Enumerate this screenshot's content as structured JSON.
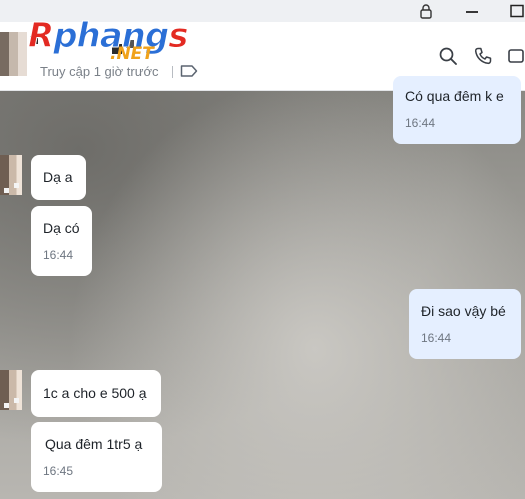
{
  "titlebar": {
    "icons": [
      "lock-icon",
      "minimize-icon",
      "maximize-icon"
    ]
  },
  "header": {
    "logo_main": "Rphangs",
    "logo_first": "R",
    "logo_mid": "phang",
    "logo_last": "s",
    "logo_sub": ".NET",
    "status": "Truy cập 1 giờ trước",
    "icons": [
      "tag-icon",
      "search-icon",
      "phone-icon",
      "video-icon"
    ]
  },
  "messages": [
    {
      "side": "out",
      "text": "Có qua đêm k e",
      "time": "16:44"
    },
    {
      "side": "in",
      "text": "Dạ a",
      "time": ""
    },
    {
      "side": "in",
      "text": "Dạ có",
      "time": "16:44"
    },
    {
      "side": "out",
      "text": "Đi sao vậy bé",
      "time": "16:44"
    },
    {
      "side": "in",
      "text": "1c a cho e 500 ạ",
      "time": ""
    },
    {
      "side": "in",
      "text": "Qua đêm 1tr5 ạ",
      "time": "16:45"
    }
  ],
  "colors": {
    "incoming_bubble": "#ffffff",
    "outgoing_bubble": "#e5efff",
    "logo_blue": "#2b6fd6",
    "logo_red": "#e32a22",
    "logo_orange": "#f0a21a"
  }
}
